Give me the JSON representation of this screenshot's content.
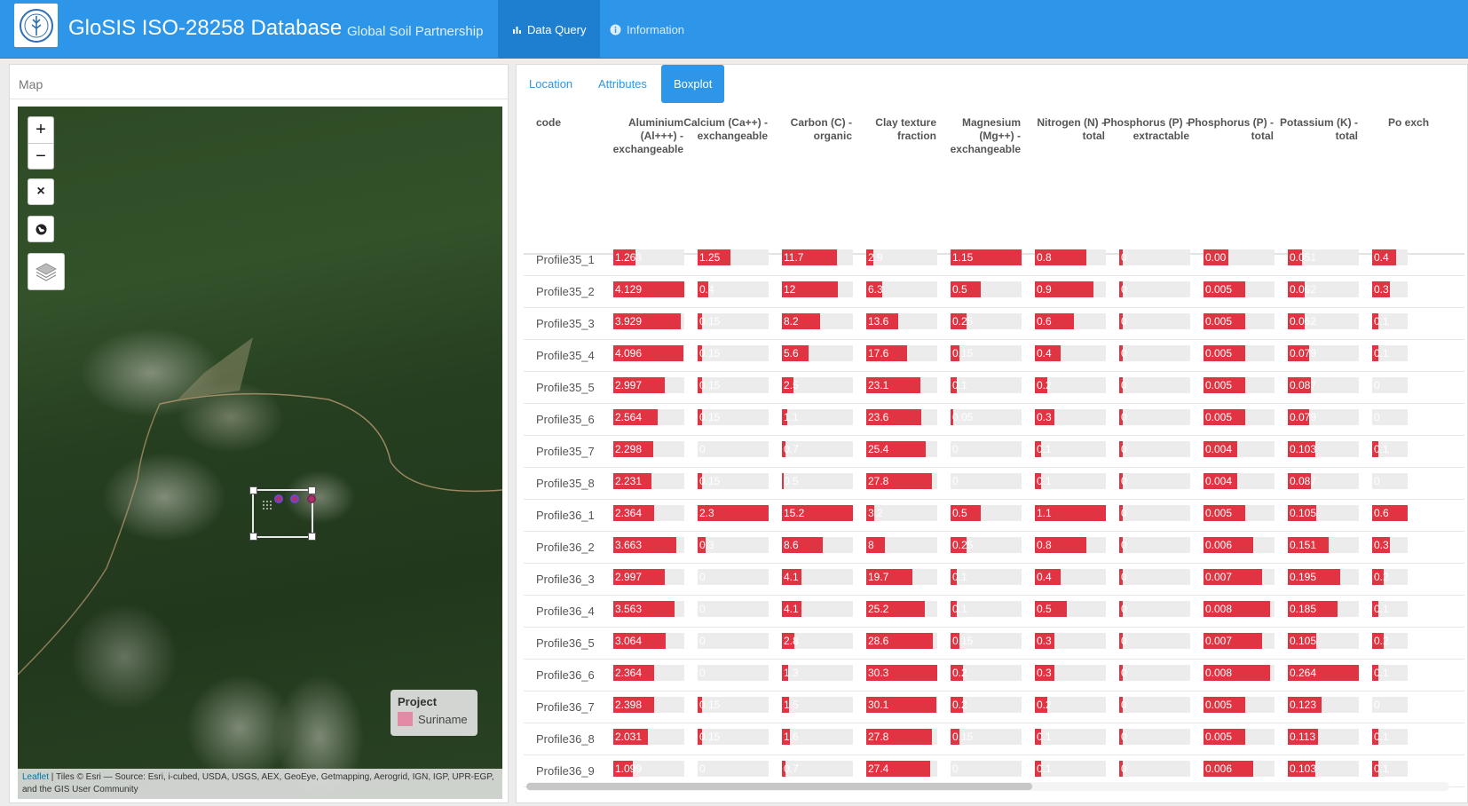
{
  "header": {
    "title": "GloSIS ISO-28258 Database",
    "subtitle": "Global Soil Partnership",
    "nav": [
      {
        "label": "Data Query",
        "icon": "bar-chart-icon"
      },
      {
        "label": "Information",
        "icon": "info-icon"
      }
    ]
  },
  "map": {
    "heading": "Map",
    "controls": [
      "+",
      "−",
      "×"
    ],
    "legend": {
      "title": "Project",
      "item": "Suriname",
      "swatch_color": "#e48aa6"
    },
    "attribution_link": "Leaflet",
    "attribution_text": " | Tiles © Esri — Source: Esri, i-cubed, USDA, USGS, AEX, GeoEye, Getmapping, Aerogrid, IGN, IGP, UPR-EGP, and the GIS User Community"
  },
  "tabs": [
    "Location",
    "Attributes",
    "Boxplot"
  ],
  "active_tab": "Boxplot",
  "bar_color": "#e03442",
  "table": {
    "columns": [
      {
        "label": "code"
      },
      {
        "label": "Aluminium (Al+++) - exchangeable"
      },
      {
        "label": "Calcium (Ca++) - exchangeable"
      },
      {
        "label": "Carbon (C) - organic"
      },
      {
        "label": "Clay texture fraction"
      },
      {
        "label": "Magnesium (Mg++) - exchangeable"
      },
      {
        "label": "Nitrogen (N) - total"
      },
      {
        "label": "Phosphorus (P) - extractable"
      },
      {
        "label": "Phosphorus (P) - total"
      },
      {
        "label": "Potassium (K) - total"
      },
      {
        "label": "Po exch"
      }
    ],
    "rows": [
      {
        "code": "Profile35_1",
        "cells": [
          {
            "t": "1.263",
            "f": 0.31
          },
          {
            "t": "1.25",
            "f": 0.46
          },
          {
            "t": "11.7",
            "f": 0.77
          },
          {
            "t": "2.9",
            "f": 0.1
          },
          {
            "t": "1.15",
            "f": 1.0
          },
          {
            "t": "0.8",
            "f": 0.73
          },
          {
            "t": "0",
            "f": 0.05
          },
          {
            "t": "0.00",
            "f": 0.35
          },
          {
            "t": "0.051",
            "f": 0.2
          },
          {
            "t": "0.4",
            "f": 0.67
          }
        ]
      },
      {
        "code": "Profile35_2",
        "cells": [
          {
            "t": "4.129",
            "f": 1.0
          },
          {
            "t": "0.4",
            "f": 0.15
          },
          {
            "t": "12",
            "f": 0.79
          },
          {
            "t": "6.3",
            "f": 0.22
          },
          {
            "t": "0.5",
            "f": 0.43
          },
          {
            "t": "0.9",
            "f": 0.82
          },
          {
            "t": "0",
            "f": 0.05
          },
          {
            "t": "0.005",
            "f": 0.59
          },
          {
            "t": "0.062",
            "f": 0.24
          },
          {
            "t": "0.3",
            "f": 0.5
          }
        ]
      },
      {
        "code": "Profile35_3",
        "cells": [
          {
            "t": "3.929",
            "f": 0.95
          },
          {
            "t": "0.15",
            "f": 0.06
          },
          {
            "t": "8.2",
            "f": 0.54
          },
          {
            "t": "13.6",
            "f": 0.45
          },
          {
            "t": "0.25",
            "f": 0.22
          },
          {
            "t": "0.6",
            "f": 0.55
          },
          {
            "t": "0",
            "f": 0.05
          },
          {
            "t": "0.005",
            "f": 0.59
          },
          {
            "t": "0.062",
            "f": 0.24
          },
          {
            "t": "0.1",
            "f": 0.17
          }
        ]
      },
      {
        "code": "Profile35_4",
        "cells": [
          {
            "t": "4.096",
            "f": 0.99
          },
          {
            "t": "0.15",
            "f": 0.06
          },
          {
            "t": "5.6",
            "f": 0.37
          },
          {
            "t": "17.6",
            "f": 0.58
          },
          {
            "t": "0.15",
            "f": 0.13
          },
          {
            "t": "0.4",
            "f": 0.36
          },
          {
            "t": "0",
            "f": 0.05
          },
          {
            "t": "0.005",
            "f": 0.59
          },
          {
            "t": "0.079",
            "f": 0.3
          },
          {
            "t": "0.1",
            "f": 0.17
          }
        ]
      },
      {
        "code": "Profile35_5",
        "cells": [
          {
            "t": "2.997",
            "f": 0.73
          },
          {
            "t": "0.15",
            "f": 0.06
          },
          {
            "t": "2.5",
            "f": 0.16
          },
          {
            "t": "23.1",
            "f": 0.76
          },
          {
            "t": "0.1",
            "f": 0.09
          },
          {
            "t": "0.2",
            "f": 0.18
          },
          {
            "t": "0",
            "f": 0.05
          },
          {
            "t": "0.005",
            "f": 0.59
          },
          {
            "t": "0.087",
            "f": 0.33
          },
          {
            "t": "0",
            "f": 0.0
          }
        ]
      },
      {
        "code": "Profile35_6",
        "cells": [
          {
            "t": "2.564",
            "f": 0.62
          },
          {
            "t": "0.15",
            "f": 0.06
          },
          {
            "t": "1.1",
            "f": 0.07
          },
          {
            "t": "23.6",
            "f": 0.78
          },
          {
            "t": "0.05",
            "f": 0.04
          },
          {
            "t": "0.3",
            "f": 0.27
          },
          {
            "t": "0",
            "f": 0.05
          },
          {
            "t": "0.005",
            "f": 0.59
          },
          {
            "t": "0.079",
            "f": 0.3
          },
          {
            "t": "0",
            "f": 0.0
          }
        ]
      },
      {
        "code": "Profile35_7",
        "cells": [
          {
            "t": "2.298",
            "f": 0.56
          },
          {
            "t": "0",
            "f": 0.0
          },
          {
            "t": "0.7",
            "f": 0.05
          },
          {
            "t": "25.4",
            "f": 0.84
          },
          {
            "t": "0",
            "f": 0.0
          },
          {
            "t": "0.1",
            "f": 0.09
          },
          {
            "t": "0",
            "f": 0.05
          },
          {
            "t": "0.004",
            "f": 0.47
          },
          {
            "t": "0.103",
            "f": 0.39
          },
          {
            "t": "0.1",
            "f": 0.17
          }
        ]
      },
      {
        "code": "Profile35_8",
        "cells": [
          {
            "t": "2.231",
            "f": 0.54
          },
          {
            "t": "0.15",
            "f": 0.06
          },
          {
            "t": "0.5",
            "f": 0.03
          },
          {
            "t": "27.8",
            "f": 0.92
          },
          {
            "t": "0",
            "f": 0.0
          },
          {
            "t": "0.1",
            "f": 0.09
          },
          {
            "t": "0",
            "f": 0.05
          },
          {
            "t": "0.004",
            "f": 0.47
          },
          {
            "t": "0.087",
            "f": 0.33
          },
          {
            "t": "0",
            "f": 0.0
          }
        ]
      },
      {
        "code": "Profile36_1",
        "cells": [
          {
            "t": "2.364",
            "f": 0.57
          },
          {
            "t": "2.3",
            "f": 1.0
          },
          {
            "t": "15.2",
            "f": 1.0
          },
          {
            "t": "3.2",
            "f": 0.11
          },
          {
            "t": "0.5",
            "f": 0.43
          },
          {
            "t": "1.1",
            "f": 1.0
          },
          {
            "t": "0",
            "f": 0.05
          },
          {
            "t": "0.005",
            "f": 0.59
          },
          {
            "t": "0.105",
            "f": 0.4
          },
          {
            "t": "0.6",
            "f": 1.0
          }
        ]
      },
      {
        "code": "Profile36_2",
        "cells": [
          {
            "t": "3.663",
            "f": 0.89
          },
          {
            "t": "0.3",
            "f": 0.11
          },
          {
            "t": "8.6",
            "f": 0.57
          },
          {
            "t": "8",
            "f": 0.26
          },
          {
            "t": "0.25",
            "f": 0.22
          },
          {
            "t": "0.8",
            "f": 0.73
          },
          {
            "t": "0",
            "f": 0.05
          },
          {
            "t": "0.006",
            "f": 0.7
          },
          {
            "t": "0.151",
            "f": 0.57
          },
          {
            "t": "0.3",
            "f": 0.5
          }
        ]
      },
      {
        "code": "Profile36_3",
        "cells": [
          {
            "t": "2.997",
            "f": 0.73
          },
          {
            "t": "0",
            "f": 0.0
          },
          {
            "t": "4.1",
            "f": 0.27
          },
          {
            "t": "19.7",
            "f": 0.65
          },
          {
            "t": "0.1",
            "f": 0.09
          },
          {
            "t": "0.4",
            "f": 0.36
          },
          {
            "t": "0",
            "f": 0.05
          },
          {
            "t": "0.007",
            "f": 0.82
          },
          {
            "t": "0.195",
            "f": 0.74
          },
          {
            "t": "0.2",
            "f": 0.33
          }
        ]
      },
      {
        "code": "Profile36_4",
        "cells": [
          {
            "t": "3.563",
            "f": 0.86
          },
          {
            "t": "0",
            "f": 0.0
          },
          {
            "t": "4.1",
            "f": 0.27
          },
          {
            "t": "25.2",
            "f": 0.83
          },
          {
            "t": "0.1",
            "f": 0.09
          },
          {
            "t": "0.5",
            "f": 0.45
          },
          {
            "t": "0",
            "f": 0.05
          },
          {
            "t": "0.008",
            "f": 0.94
          },
          {
            "t": "0.185",
            "f": 0.7
          },
          {
            "t": "0.1",
            "f": 0.17
          }
        ]
      },
      {
        "code": "Profile36_5",
        "cells": [
          {
            "t": "3.064",
            "f": 0.74
          },
          {
            "t": "0",
            "f": 0.0
          },
          {
            "t": "2.8",
            "f": 0.18
          },
          {
            "t": "28.6",
            "f": 0.94
          },
          {
            "t": "0.15",
            "f": 0.13
          },
          {
            "t": "0.3",
            "f": 0.27
          },
          {
            "t": "0",
            "f": 0.05
          },
          {
            "t": "0.007",
            "f": 0.82
          },
          {
            "t": "0.105",
            "f": 0.4
          },
          {
            "t": "0.2",
            "f": 0.33
          }
        ]
      },
      {
        "code": "Profile36_6",
        "cells": [
          {
            "t": "2.364",
            "f": 0.57
          },
          {
            "t": "0",
            "f": 0.0
          },
          {
            "t": "1.3",
            "f": 0.09
          },
          {
            "t": "30.3",
            "f": 1.0
          },
          {
            "t": "0.2",
            "f": 0.17
          },
          {
            "t": "0.3",
            "f": 0.27
          },
          {
            "t": "0",
            "f": 0.05
          },
          {
            "t": "0.008",
            "f": 0.94
          },
          {
            "t": "0.264",
            "f": 1.0
          },
          {
            "t": "0.1",
            "f": 0.17
          }
        ]
      },
      {
        "code": "Profile36_7",
        "cells": [
          {
            "t": "2.398",
            "f": 0.58
          },
          {
            "t": "0.15",
            "f": 0.06
          },
          {
            "t": "1.5",
            "f": 0.1
          },
          {
            "t": "30.1",
            "f": 0.99
          },
          {
            "t": "0.2",
            "f": 0.17
          },
          {
            "t": "0.2",
            "f": 0.18
          },
          {
            "t": "0",
            "f": 0.05
          },
          {
            "t": "0.005",
            "f": 0.59
          },
          {
            "t": "0.123",
            "f": 0.47
          },
          {
            "t": "0",
            "f": 0.0
          }
        ]
      },
      {
        "code": "Profile36_8",
        "cells": [
          {
            "t": "2.031",
            "f": 0.49
          },
          {
            "t": "0.15",
            "f": 0.06
          },
          {
            "t": "1.6",
            "f": 0.11
          },
          {
            "t": "27.8",
            "f": 0.92
          },
          {
            "t": "0.15",
            "f": 0.13
          },
          {
            "t": "0.1",
            "f": 0.09
          },
          {
            "t": "0",
            "f": 0.05
          },
          {
            "t": "0.005",
            "f": 0.59
          },
          {
            "t": "0.113",
            "f": 0.43
          },
          {
            "t": "0.1",
            "f": 0.17
          }
        ]
      },
      {
        "code": "Profile36_9",
        "cells": [
          {
            "t": "1.099",
            "f": 0.27
          },
          {
            "t": "0",
            "f": 0.0
          },
          {
            "t": "0.7",
            "f": 0.05
          },
          {
            "t": "27.4",
            "f": 0.9
          },
          {
            "t": "0",
            "f": 0.0
          },
          {
            "t": "0.1",
            "f": 0.09
          },
          {
            "t": "0",
            "f": 0.05
          },
          {
            "t": "0.006",
            "f": 0.7
          },
          {
            "t": "0.103",
            "f": 0.39
          },
          {
            "t": "0.1",
            "f": 0.17
          }
        ]
      }
    ]
  }
}
